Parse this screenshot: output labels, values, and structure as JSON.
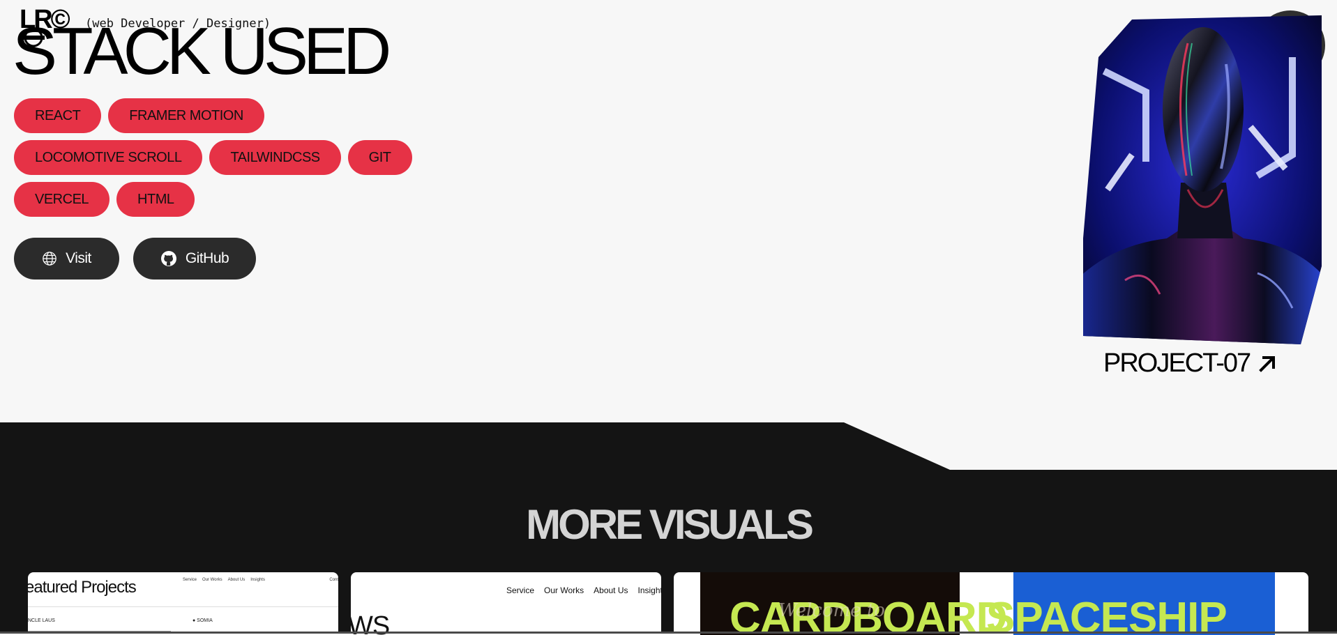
{
  "header": {
    "logo_text": "LR©",
    "subtitle": "(web Developer / Designer)",
    "menu_icon": "hamburger-icon"
  },
  "stack": {
    "title": "STACK USED",
    "tag_color": "#e63246",
    "rows": [
      [
        "REACT",
        "FRAMER MOTION"
      ],
      [
        "LOCOMOTIVE SCROLL",
        "TAILWINDCSS",
        "GIT"
      ],
      [
        "VERCEL",
        "HTML"
      ]
    ]
  },
  "actions": {
    "visit_label": "Visit",
    "visit_icon": "globe-icon",
    "github_label": "GitHub",
    "github_icon": "github-icon"
  },
  "project": {
    "label": "PROJECT-07",
    "arrow_icon": "arrow-up-right-icon"
  },
  "more_visuals": {
    "title": "MORE VISUALS",
    "thumb1": {
      "title": "eatured Projects",
      "nav": [
        "Service",
        "Our Works",
        "About Us",
        "Insights"
      ],
      "corner": "Cont",
      "label_left": "NCLE LAUS",
      "label_right": "● SOMIA"
    },
    "thumb2": {
      "nav": [
        "Service",
        "Our Works",
        "About Us",
        "Insights"
      ],
      "big_text": "WS"
    },
    "thumb3": {
      "word_left": "CARDBOARD",
      "script_overlay": "Welcome to",
      "word_right": "SPACESHIP"
    }
  }
}
